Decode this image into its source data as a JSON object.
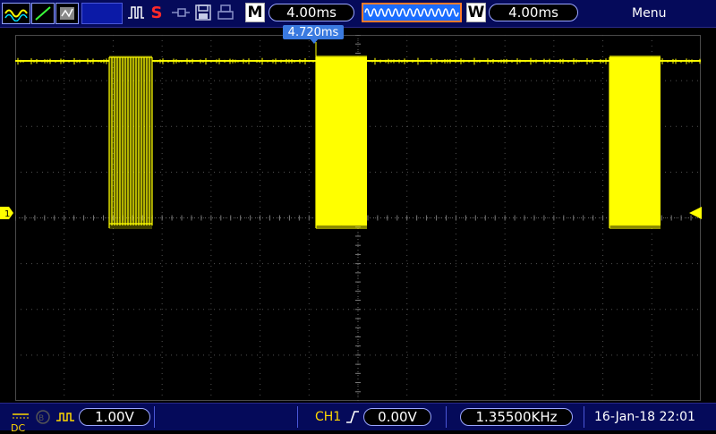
{
  "toolbar": {
    "icons": [
      "waveform-icon",
      "line-icon",
      "persistence-icon",
      "pulse-icon",
      "stop-icon",
      "probe-icon",
      "save-icon",
      "print-icon"
    ],
    "run_state_label": "S",
    "mode_label": "M",
    "timebase": "4.00ms",
    "window_label": "W",
    "window_timebase": "4.00ms",
    "menu_label": "Menu"
  },
  "screen": {
    "trigger_position_tag": "4.720ms",
    "channel_marker": "1",
    "trace_color": "#ffff00"
  },
  "bottom": {
    "dc_label": "DC",
    "volts_per_div": "1.00V",
    "channel_label": "CH1",
    "trigger_level": "0.00V",
    "frequency": "1.35500KHz",
    "datetime": "16-Jan-18 22:01"
  },
  "colors": {
    "bar_bg": "#050a5a",
    "accent": "#ffff00",
    "pill_border": "#9aa6ff",
    "tag_blue": "#3a7ae0"
  }
}
